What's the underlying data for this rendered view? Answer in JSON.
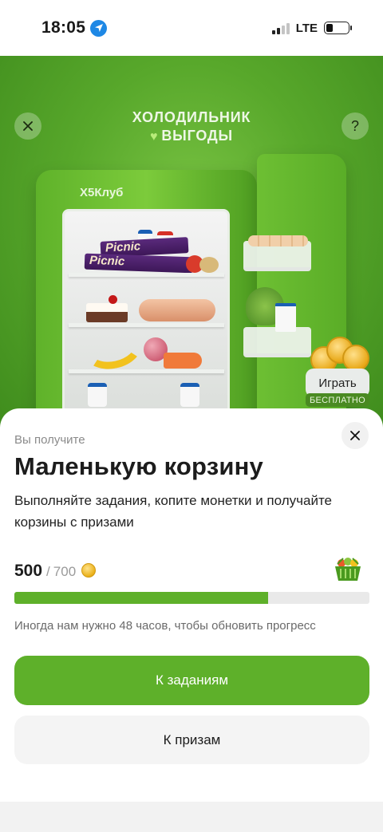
{
  "status_bar": {
    "time": "18:05",
    "network": "LTE",
    "battery_level": 0.3
  },
  "hero": {
    "title_line1": "ХОЛОДИЛЬНИК",
    "title_line2": "ВЫГОДЫ",
    "fridge_brand": "Х5Клуб",
    "snack_label": "Picnic",
    "play_label": "Играть",
    "free_label": "БЕСПЛАТНО",
    "help_glyph": "?"
  },
  "sheet": {
    "caption": "Вы получите",
    "title": "Маленькую корзину",
    "description": "Выполняйте задания, копите монетки и получайте корзины с призами",
    "progress": {
      "current": "500",
      "separator": "/",
      "total": "700",
      "fraction": 0.714
    },
    "note": "Иногда нам нужно 48 часов, чтобы обновить прогресс",
    "primary_button": "К заданиям",
    "secondary_button": "К призам"
  },
  "colors": {
    "accent": "#5eb02a",
    "hero_bg": "#58a82b"
  }
}
